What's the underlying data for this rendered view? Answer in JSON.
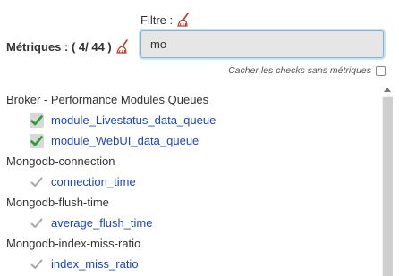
{
  "filter": {
    "label": "Filtre :",
    "value": "mo"
  },
  "metrics": {
    "label": "Métriques : ( 4/ 44 )"
  },
  "hide_checks": {
    "label": "Cacher les checks sans métriques",
    "checked": false
  },
  "groups": [
    {
      "title": "Broker - Performance Modules Queues",
      "items": [
        {
          "label": "module_Livestatus_data_queue",
          "checked": true
        },
        {
          "label": "module_WebUI_data_queue",
          "checked": true
        }
      ]
    },
    {
      "title": "Mongodb-connection",
      "items": [
        {
          "label": "connection_time",
          "checked": false
        }
      ]
    },
    {
      "title": "Mongodb-flush-time",
      "items": [
        {
          "label": "average_flush_time",
          "checked": false
        }
      ]
    },
    {
      "title": "Mongodb-index-miss-ratio",
      "items": [
        {
          "label": "index_miss_ratio",
          "checked": false
        }
      ]
    }
  ],
  "colors": {
    "link": "#1a44c8",
    "check_active": "#2e9e2e",
    "check_inactive": "#a8a8a8",
    "broom": "#c0392b"
  },
  "icons": {
    "clear_filter": "broom-icon",
    "checked": "checkmark-icon",
    "scroll_up": "chevron-up-icon"
  }
}
